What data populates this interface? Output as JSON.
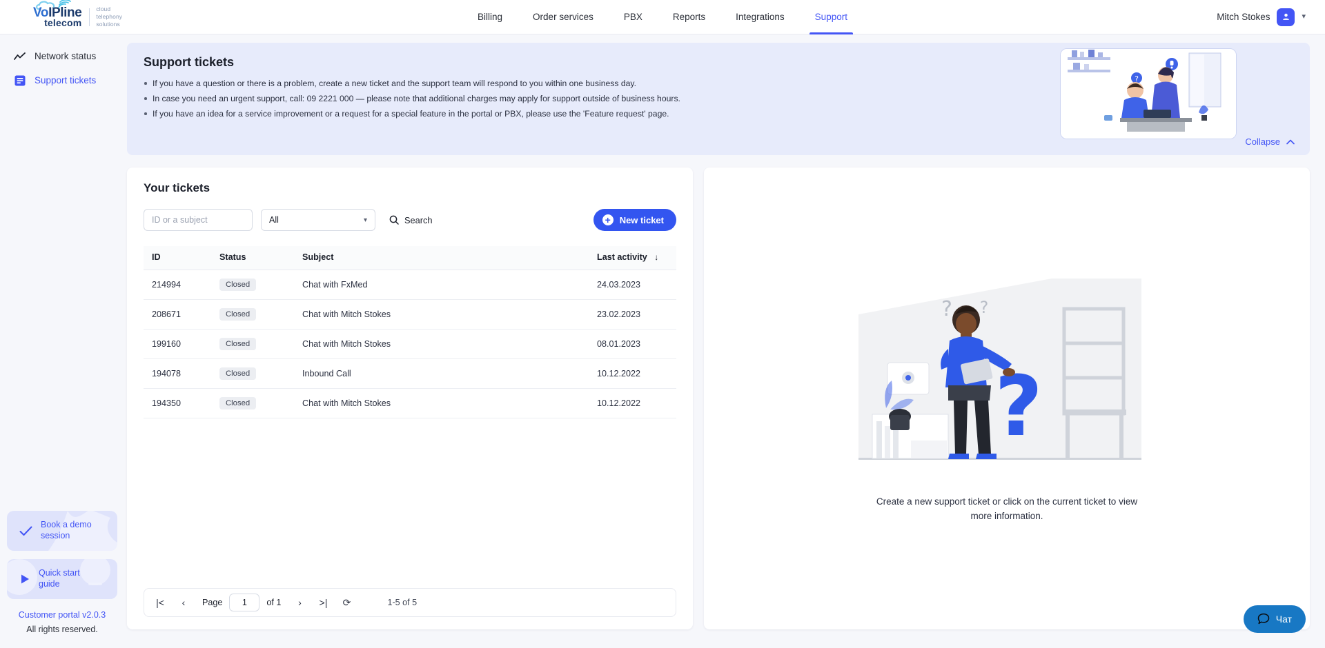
{
  "brand": {
    "logo_top": "VoIPline",
    "logo_top_prefix": "Vo",
    "logo_bottom": "telecom",
    "tagline_line1": "cloud",
    "tagline_line2": "telephony",
    "tagline_line3": "solutions",
    "accent": "#4355f5",
    "primary_button": "#3355f0",
    "chat_color": "#1878c4"
  },
  "nav": {
    "items": [
      {
        "label": "Billing",
        "active": false
      },
      {
        "label": "Order services",
        "active": false
      },
      {
        "label": "PBX",
        "active": false
      },
      {
        "label": "Reports",
        "active": false
      },
      {
        "label": "Integrations",
        "active": false
      },
      {
        "label": "Support",
        "active": true
      }
    ]
  },
  "user": {
    "name": "Mitch Stokes",
    "avatar_icon": "person-icon",
    "chevron": "∨"
  },
  "sidebar": {
    "items": [
      {
        "label": "Network status",
        "icon": "trend-line-icon",
        "active": false
      },
      {
        "label": "Support tickets",
        "icon": "document-list-icon",
        "active": true
      }
    ],
    "promos": [
      {
        "label": "Book a demo session",
        "icon": "check-icon"
      },
      {
        "label": "Quick start guide",
        "icon": "play-icon"
      }
    ],
    "portal_version": "Customer portal v2.0.3",
    "rights": "All rights reserved."
  },
  "banner": {
    "title": "Support tickets",
    "bullets": [
      "If you have a question or there is a problem, create a new ticket and the support team will respond to you within one business day.",
      "In case you need an urgent support, call: 09 2221 000 — please note that additional charges may apply for support outside of business hours.",
      "If you have an idea for a service improvement or a request for a special feature in the portal or PBX, please use the 'Feature request' page."
    ],
    "collapse_label": "Collapse",
    "collapse_icon": "chevron-up-icon"
  },
  "tickets": {
    "title": "Your tickets",
    "search_placeholder": "ID or a subject",
    "search_value": "",
    "filter_value": "All",
    "filter_options": [
      "All"
    ],
    "search_button": "Search",
    "new_ticket_button": "New ticket",
    "columns": [
      "ID",
      "Status",
      "Subject",
      "Last activity"
    ],
    "sort_column": "Last activity",
    "sort_direction": "desc",
    "rows": [
      {
        "id": "214994",
        "status": "Closed",
        "subject": "Chat with FxMed",
        "last_activity": "24.03.2023"
      },
      {
        "id": "208671",
        "status": "Closed",
        "subject": "Chat with Mitch Stokes",
        "last_activity": "23.02.2023"
      },
      {
        "id": "199160",
        "status": "Closed",
        "subject": "Chat with Mitch Stokes",
        "last_activity": "08.01.2023"
      },
      {
        "id": "194078",
        "status": "Closed",
        "subject": "Inbound Call",
        "last_activity": "10.12.2022"
      },
      {
        "id": "194350",
        "status": "Closed",
        "subject": "Chat with Mitch Stokes",
        "last_activity": "10.12.2022"
      }
    ],
    "pagination": {
      "first_icon": "|<",
      "prev_icon": "‹",
      "page_label": "Page",
      "page_value": "1",
      "of_label": "of 1",
      "next_icon": "›",
      "last_icon": ">|",
      "refresh_icon": "⟳",
      "range": "1-5 of 5"
    }
  },
  "detail": {
    "empty_message": "Create a new support ticket or click on the current ticket to view more information.",
    "illustration": "woman-with-question-mark-illustration"
  },
  "chat": {
    "label": "Чат",
    "icon": "chat-bubble-icon"
  }
}
